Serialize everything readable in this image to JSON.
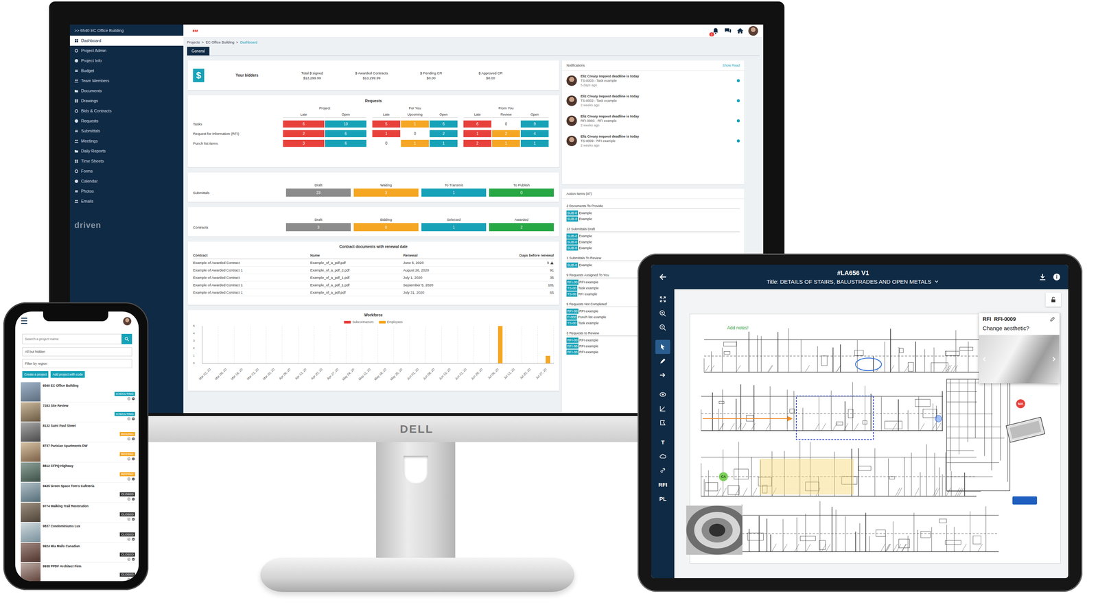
{
  "monitor": {
    "brand": "DELL",
    "sidebar": {
      "project": ">> 6540 EC Office Building",
      "items": [
        {
          "label": "Dashboard",
          "selected": true
        },
        {
          "label": "Project Admin",
          "selected": false
        },
        {
          "label": "Project Info",
          "selected": false
        },
        {
          "label": "Budget",
          "selected": false
        },
        {
          "label": "Team Members",
          "selected": false
        },
        {
          "label": "Documents",
          "selected": false
        },
        {
          "label": "Drawings",
          "selected": false
        },
        {
          "label": "Bids & Contracts",
          "selected": false
        },
        {
          "label": "Requests",
          "selected": false
        },
        {
          "label": "Submittals",
          "selected": false
        },
        {
          "label": "Meetings",
          "selected": false
        },
        {
          "label": "Daily Reports",
          "selected": false
        },
        {
          "label": "Time Sheets",
          "selected": false
        },
        {
          "label": "Forms",
          "selected": false
        },
        {
          "label": "Calendar",
          "selected": false
        },
        {
          "label": "Photos",
          "selected": false
        },
        {
          "label": "Emails",
          "selected": false
        }
      ],
      "logo": "driven"
    },
    "header": {
      "notification_count": "1"
    },
    "breadcrumb": {
      "separator": ">",
      "items": [
        {
          "label": "Projects",
          "selected": false
        },
        {
          "label": "EC Office Building",
          "selected": false
        },
        {
          "label": "Dashboard",
          "selected": true
        }
      ]
    },
    "tabs": [
      {
        "label": "General",
        "selected": true
      }
    ],
    "bidders": {
      "icon": "$",
      "label": "Your bidders",
      "stats": [
        {
          "label": "Total $ signed",
          "value": "$13,299.99"
        },
        {
          "label": "$ Awarded Contracts",
          "value": "$13,299.99"
        },
        {
          "label": "$ Pending CR",
          "value": "$0.00"
        },
        {
          "label": "$ Approved CR",
          "value": "$0.00"
        }
      ]
    },
    "requests": {
      "title": "Requests",
      "groups": [
        {
          "label": "Project",
          "columns": [
            "Late",
            "Open"
          ]
        },
        {
          "label": "For You",
          "columns": [
            "Late",
            "Upcoming",
            "Open"
          ]
        },
        {
          "label": "From You",
          "columns": [
            "Late",
            "Review",
            "Open"
          ]
        }
      ],
      "rows": [
        {
          "label": "Tasks",
          "cells": [
            {
              "value": "6",
              "color": "#e8413c"
            },
            {
              "value": "10",
              "color": "#17a2b8"
            },
            {
              "value": "5",
              "color": "#e8413c"
            },
            {
              "value": "1",
              "color": "#f5a623"
            },
            {
              "value": "6",
              "color": "#17a2b8"
            },
            {
              "value": "6",
              "color": "#e8413c"
            },
            {
              "value": "0",
              "color": "#ffffff"
            },
            {
              "value": "9",
              "color": "#17a2b8"
            }
          ]
        },
        {
          "label": "Request for Information (RFI)",
          "cells": [
            {
              "value": "2",
              "color": "#e8413c"
            },
            {
              "value": "6",
              "color": "#17a2b8"
            },
            {
              "value": "1",
              "color": "#e8413c"
            },
            {
              "value": "0",
              "color": "#ffffff"
            },
            {
              "value": "2",
              "color": "#17a2b8"
            },
            {
              "value": "1",
              "color": "#e8413c"
            },
            {
              "value": "2",
              "color": "#f5a623"
            },
            {
              "value": "4",
              "color": "#17a2b8"
            }
          ]
        },
        {
          "label": "Punch list items",
          "cells": [
            {
              "value": "3",
              "color": "#e8413c"
            },
            {
              "value": "6",
              "color": "#17a2b8"
            },
            {
              "value": "0",
              "color": "#ffffff"
            },
            {
              "value": "1",
              "color": "#f5a623"
            },
            {
              "value": "1",
              "color": "#17a2b8"
            },
            {
              "value": "2",
              "color": "#e8413c"
            },
            {
              "value": "1",
              "color": "#f5a623"
            },
            {
              "value": "1",
              "color": "#17a2b8"
            }
          ]
        }
      ]
    },
    "pipelines": [
      {
        "label": "Submittals",
        "stages": [
          {
            "label": "Draft",
            "count": "23",
            "color": "#8c8c8c"
          },
          {
            "label": "Waiting",
            "count": "3",
            "color": "#f5a623"
          },
          {
            "label": "To Transmit",
            "count": "1",
            "color": "#17a2b8"
          },
          {
            "label": "To Publish",
            "count": "0",
            "color": "#28a745"
          }
        ]
      },
      {
        "label": "Contracts",
        "stages": [
          {
            "label": "Draft",
            "count": "3",
            "color": "#8c8c8c"
          },
          {
            "label": "Bidding",
            "count": "0",
            "color": "#f5a623"
          },
          {
            "label": "Selected",
            "count": "1",
            "color": "#17a2b8"
          },
          {
            "label": "Awarded",
            "count": "2",
            "color": "#28a745"
          }
        ]
      }
    ],
    "renewals": {
      "title": "Contract documents with renewal date",
      "columns": [
        "Contract",
        "Name",
        "Renewal",
        "Days before renewal"
      ],
      "rows": [
        {
          "contract": "Example of Awarded Contract",
          "name": "Example_of_a_pdf.pdf",
          "renewal": "June 5, 2020",
          "days": "9",
          "warning": true
        },
        {
          "contract": "Example of Awarded Contract 1",
          "name": "Example_of_a_pdf_2.pdf",
          "renewal": "August 26, 2020",
          "days": "91",
          "warning": false
        },
        {
          "contract": "Example of Awarded Contract",
          "name": "Example_of_a_pdf_1.pdf",
          "renewal": "July 1, 2020",
          "days": "35",
          "warning": false
        },
        {
          "contract": "Example of Awarded Contract 1",
          "name": "Example_of_a_pdf_1.pdf",
          "renewal": "September 5, 2020",
          "days": "101",
          "warning": false
        },
        {
          "contract": "Example of Awarded Contract 1",
          "name": "Example_of_a_pdf.pdf",
          "renewal": "July 31, 2020",
          "days": "65",
          "warning": false
        }
      ]
    },
    "workforce": {
      "title": "Workforce",
      "y_ticks": [
        "0",
        "1",
        "2",
        "3",
        "4",
        "5"
      ],
      "x_labels": [
        "Mar 02, 20",
        "Mar 09, 20",
        "Mar 16, 20",
        "Mar 23, 20",
        "Mar 30, 20",
        "Apr 06, 20",
        "Apr 13, 20",
        "Apr 20, 20",
        "Apr 27, 20",
        "May 04, 20",
        "May 11, 20",
        "May 18, 20",
        "May 25, 20",
        "Jun 01, 20",
        "Jun 08, 20",
        "Jun 15, 20",
        "Jun 22, 20",
        "Jun 29, 20",
        "Jul 06, 20",
        "Jul 13, 20",
        "Jul 20, 20",
        "Jul 27, 20"
      ],
      "series": [
        {
          "name": "Subcontractors",
          "color": "#e8413c",
          "values": [
            0,
            0,
            0,
            0,
            0,
            0,
            0,
            0,
            0,
            0,
            0,
            0,
            0,
            0,
            0,
            0,
            0,
            0,
            0,
            0,
            0,
            0
          ]
        },
        {
          "name": "Employees",
          "color": "#f5a623",
          "values": [
            0,
            0,
            0,
            0,
            0,
            0,
            0,
            0,
            0,
            0,
            0,
            0,
            0,
            0,
            0,
            0,
            0,
            0,
            5,
            0,
            0,
            1
          ]
        }
      ]
    },
    "notifications": {
      "title": "Notifications",
      "show_read": "Show Read",
      "items": [
        {
          "title": "Eliz Creary request deadline is today",
          "subtitle": "TS-0003 - Task example",
          "time": "5 days ago",
          "unread": true
        },
        {
          "title": "Eliz Creary request deadline is today",
          "subtitle": "TS-0002 - Task example",
          "time": "2 weeks ago",
          "unread": true
        },
        {
          "title": "Eliz Creary request deadline is today",
          "subtitle": "RFI-0003 - RFI example",
          "time": "2 weeks ago",
          "unread": true
        },
        {
          "title": "Eliz Creary request deadline is today",
          "subtitle": "TS-0009 - RFI example",
          "time": "2 weeks ago",
          "unread": true
        }
      ]
    },
    "action_items": {
      "title": "Action Items (47)",
      "groups": [
        {
          "title": "2 Documents To Provide",
          "items": [
            {
              "tag": "SUB-0",
              "label": "Example"
            },
            {
              "tag": "SUB-0",
              "label": "Example"
            }
          ]
        },
        {
          "title": "23 Submittals Draft",
          "items": [
            {
              "tag": "SUB-0",
              "label": "Example"
            },
            {
              "tag": "SUB-0",
              "label": "Example"
            },
            {
              "tag": "SUB-0",
              "label": "Example"
            }
          ]
        },
        {
          "title": "1 Submittals To Review",
          "items": [
            {
              "tag": "SUB-0",
              "label": "Example"
            }
          ]
        },
        {
          "title": "9 Requests Assigned To You",
          "items": [
            {
              "tag": "RFI-00",
              "label": "RFI example"
            },
            {
              "tag": "TS-00",
              "label": "Task example"
            },
            {
              "tag": "TS-00",
              "label": "RFI example"
            }
          ]
        },
        {
          "title": "9 Requests Not Completed",
          "items": [
            {
              "tag": "RFI-00",
              "label": "RFI example"
            },
            {
              "tag": "P-000",
              "label": "Punch list example"
            },
            {
              "tag": "TS-00",
              "label": "Task example"
            }
          ]
        },
        {
          "title": "3 Requests to Review",
          "items": [
            {
              "tag": "RFI-00",
              "label": "RFI example"
            },
            {
              "tag": "RFI-00",
              "label": "RFI example"
            },
            {
              "tag": "RFI-00",
              "label": "RFI example"
            }
          ]
        }
      ]
    }
  },
  "phone": {
    "menu_icon": "☰",
    "search": {
      "placeholder": "Search a project name"
    },
    "filters": [
      "All but hidden",
      "Filter by region"
    ],
    "buttons": [
      "Create a project",
      "Add project with code"
    ],
    "projects": [
      {
        "name": "6540 EC Office Building",
        "status": "EXECUTING",
        "color": "#17a2b8"
      },
      {
        "name": "7283 Site Review",
        "status": "EXECUTING",
        "color": "#17a2b8"
      },
      {
        "name": "8132 Saint Paul Street",
        "status": "BIDDING",
        "color": "#f5a623"
      },
      {
        "name": "8737 Parisian Apartments DW",
        "status": "BIDDING",
        "color": "#f5a623"
      },
      {
        "name": "8812 CFPQ Highway",
        "status": "BIDDING",
        "color": "#f5a623"
      },
      {
        "name": "9435 Green Space Tom's Cafeteria",
        "status": "CLOSED",
        "color": "#3a3a3a"
      },
      {
        "name": "9774 Walking Trail Restoration",
        "status": "CLOSED",
        "color": "#3a3a3a"
      },
      {
        "name": "9837 Condominiums Lux",
        "status": "CLOSED",
        "color": "#3a3a3a"
      },
      {
        "name": "9924 Mia Malls Canadian",
        "status": "CLOSED",
        "color": "#3a3a3a"
      },
      {
        "name": "9938 PPDF Architect Firm",
        "status": "CLOSED",
        "color": "#3a3a3a"
      }
    ]
  },
  "tablet": {
    "code": "#LA656 V1",
    "title": "Title: DETAILS OF STAIRS, BALUSTRADES AND OPEN METALS",
    "tools": [
      {
        "kind": "icon",
        "selected": false
      },
      {
        "kind": "icon",
        "selected": false
      },
      {
        "kind": "icon",
        "selected": false
      },
      {
        "kind": "icon",
        "selected": true
      },
      {
        "kind": "icon",
        "selected": false
      },
      {
        "kind": "icon",
        "selected": false
      },
      {
        "kind": "icon",
        "selected": false
      },
      {
        "kind": "icon",
        "selected": false
      },
      {
        "kind": "icon",
        "selected": false
      },
      {
        "kind": "text",
        "label": "T",
        "selected": false
      },
      {
        "kind": "icon",
        "selected": false
      },
      {
        "kind": "icon",
        "selected": false
      },
      {
        "kind": "text",
        "label": "RFI",
        "selected": false
      },
      {
        "kind": "text",
        "label": "PL",
        "selected": false
      }
    ],
    "note": "Add notes!",
    "markers": [
      {
        "label": "CA",
        "color": "#7ccf5a"
      },
      {
        "label": "MA",
        "color": "#e8413c"
      }
    ],
    "rfi": {
      "type": "RFI",
      "code": "RFI-0009",
      "question": "Change aesthetic?"
    }
  }
}
